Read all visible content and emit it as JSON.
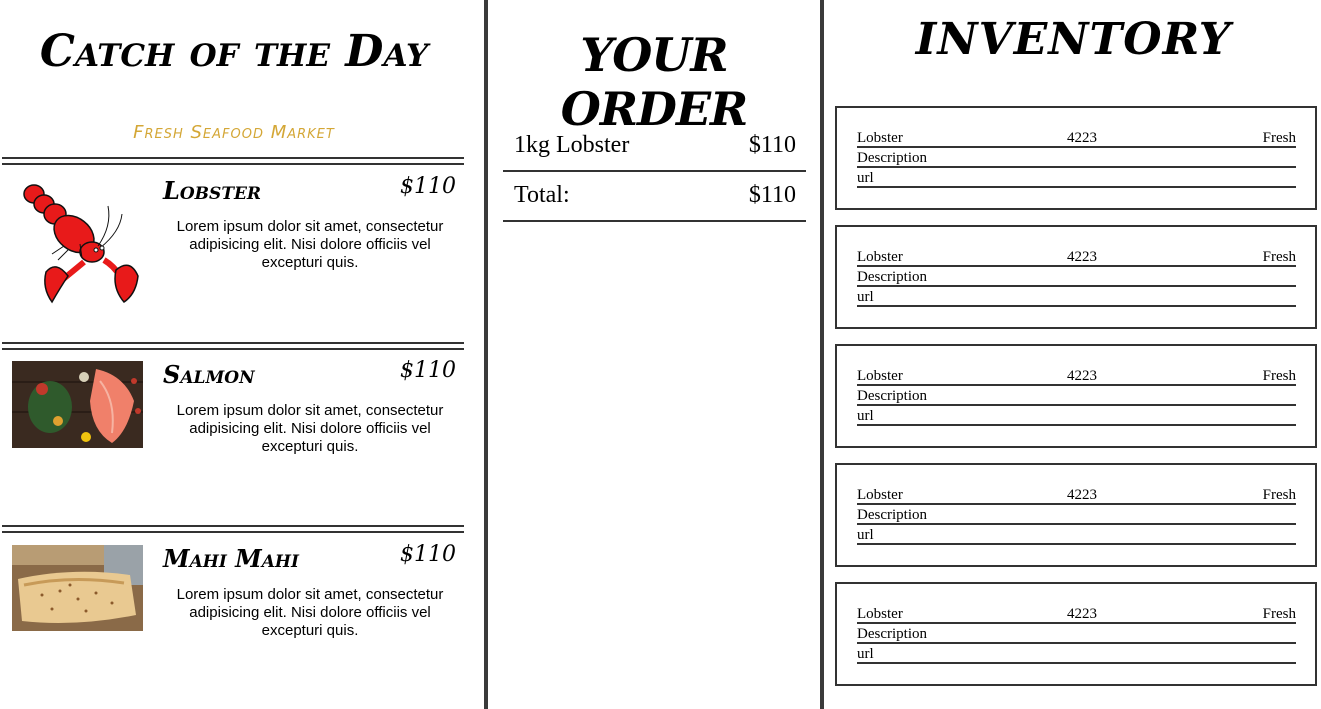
{
  "menu": {
    "title": "Catch of the Day",
    "tagline": "Fresh Seafood Market",
    "items": [
      {
        "name": "Lobster",
        "price": "$110",
        "description": "Lorem ipsum dolor sit amet, consectetur adipisicing elit. Nisi dolore officiis vel excepturi quis.",
        "image": "lobster-image"
      },
      {
        "name": "Salmon",
        "price": "$110",
        "description": "Lorem ipsum dolor sit amet, consectetur adipisicing elit. Nisi dolore officiis vel excepturi quis.",
        "image": "salmon-image"
      },
      {
        "name": "Mahi Mahi",
        "price": "$110",
        "description": "Lorem ipsum dolor sit amet, consectetur adipisicing elit. Nisi dolore officiis vel excepturi quis.",
        "image": "mahi-mahi-image"
      }
    ]
  },
  "order": {
    "title": "YOUR ORDER",
    "line_item": {
      "label": "1kg Lobster",
      "price": "$110"
    },
    "total": {
      "label": "Total:",
      "price": "$110"
    }
  },
  "inventory": {
    "title": "INVENTORY",
    "cards": [
      {
        "name": "Lobster",
        "price": "4223",
        "status": "Fresh",
        "description": "Description",
        "url": "url"
      },
      {
        "name": "Lobster",
        "price": "4223",
        "status": "Fresh",
        "description": "Description",
        "url": "url"
      },
      {
        "name": "Lobster",
        "price": "4223",
        "status": "Fresh",
        "description": "Description",
        "url": "url"
      },
      {
        "name": "Lobster",
        "price": "4223",
        "status": "Fresh",
        "description": "Description",
        "url": "url"
      },
      {
        "name": "Lobster",
        "price": "4223",
        "status": "Fresh",
        "description": "Description",
        "url": "url"
      }
    ]
  },
  "colors": {
    "tagline": "#d4a736",
    "divider": "#3a3a3a",
    "lobster": "#e81a1a"
  }
}
